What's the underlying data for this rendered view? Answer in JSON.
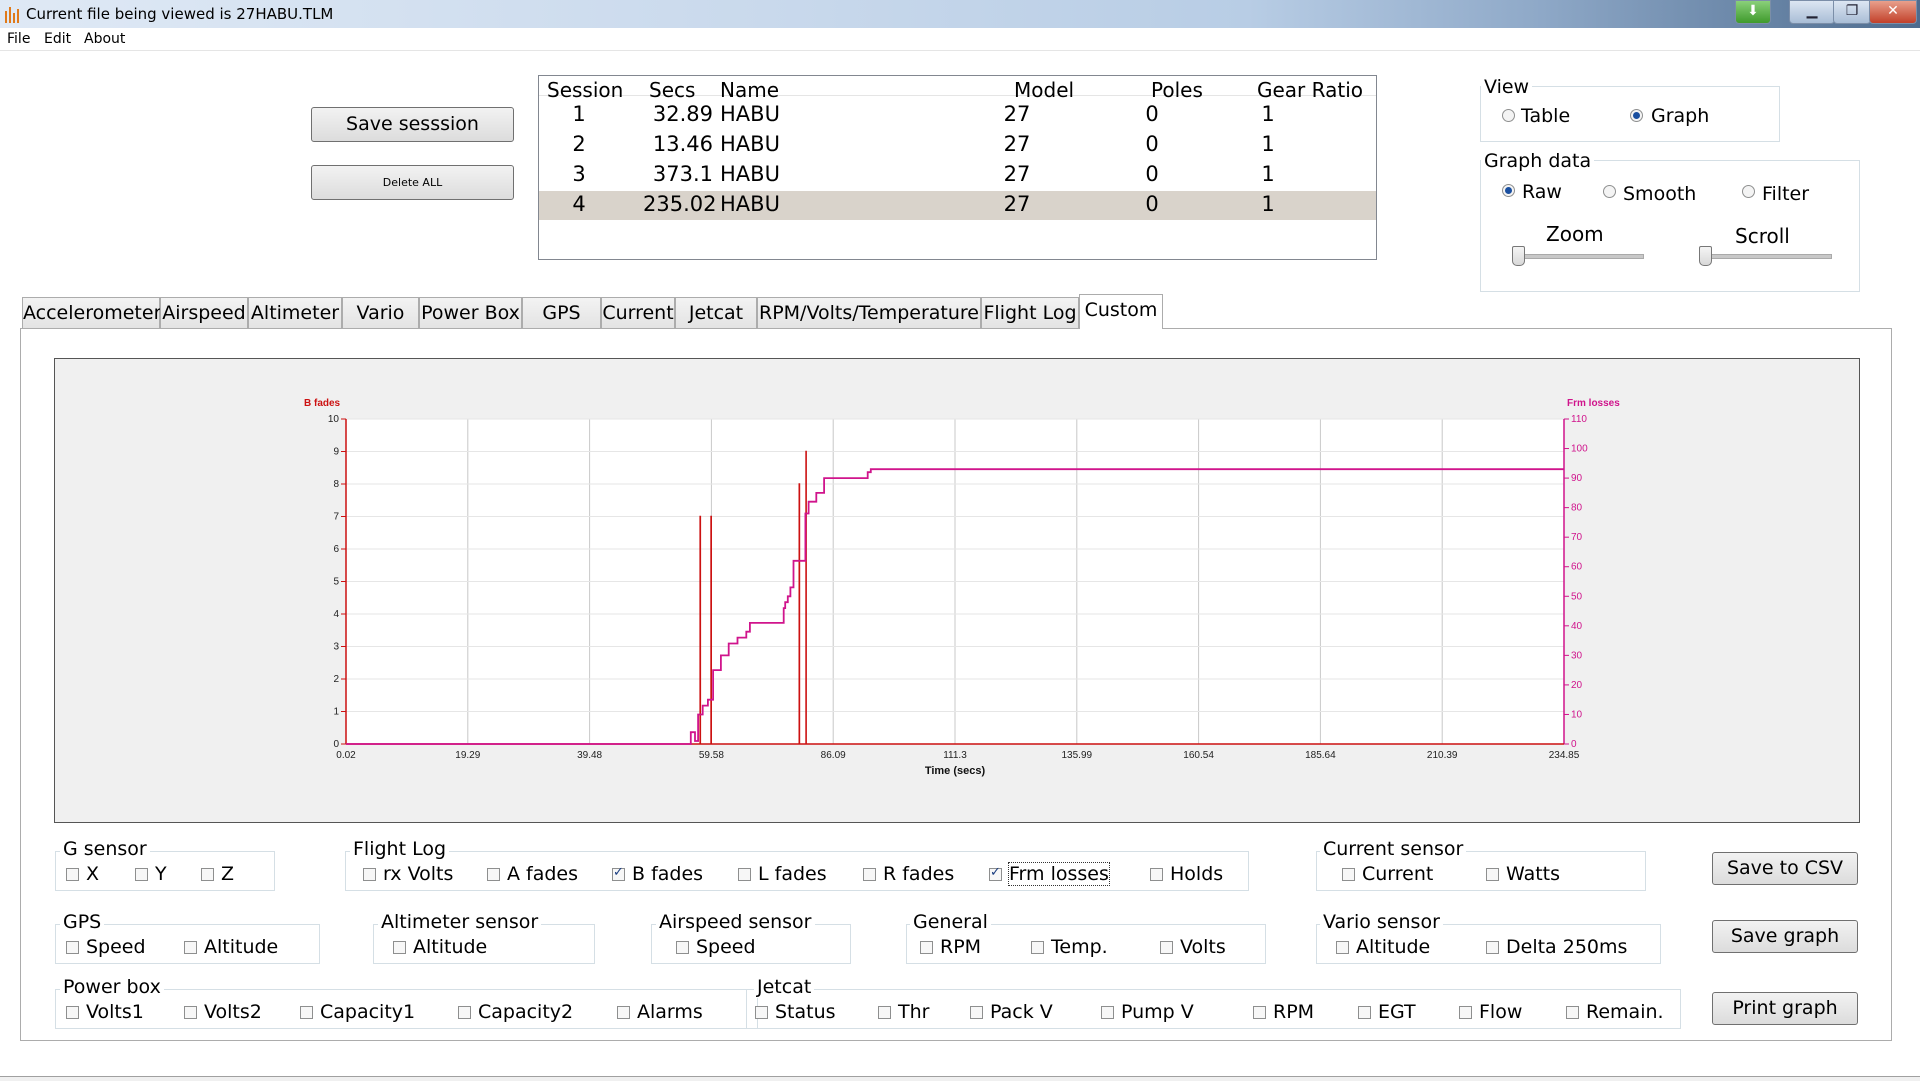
{
  "window": {
    "title": "Current file being viewed is 27HABU.TLM"
  },
  "menu": [
    "File",
    "Edit",
    "About"
  ],
  "buttons": {
    "save_session": "Save sesssion",
    "delete_all": "Delete ALL",
    "save_csv": "Save to CSV",
    "save_graph": "Save graph",
    "print_graph": "Print graph"
  },
  "sessions": {
    "headers": [
      "Session",
      "Secs",
      "Name",
      "Model",
      "Poles",
      "Gear Ratio"
    ],
    "rows": [
      [
        "1",
        "32.89",
        "HABU",
        "27",
        "0",
        "1"
      ],
      [
        "2",
        "13.46",
        "HABU",
        "27",
        "0",
        "1"
      ],
      [
        "3",
        "373.1",
        "HABU",
        "27",
        "0",
        "1"
      ],
      [
        "4",
        "235.02",
        "HABU",
        "27",
        "0",
        "1"
      ]
    ],
    "selected_row": 4
  },
  "view": {
    "label": "View",
    "options": [
      "Table",
      "Graph"
    ],
    "selected": "Graph"
  },
  "graph_data": {
    "label": "Graph data",
    "options": [
      "Raw",
      "Smooth",
      "Filter"
    ],
    "selected": "Raw",
    "zoom_label": "Zoom",
    "scroll_label": "Scroll"
  },
  "tabs": [
    "Accelerometer",
    "Airspeed",
    "Altimeter",
    "Vario",
    "Power Box",
    "GPS",
    "Current",
    "Jetcat",
    "RPM/Volts/Temperature",
    "Flight Log",
    "Custom"
  ],
  "active_tab": "Custom",
  "colors": {
    "b_fades": "#cc1111",
    "frm_losses": "#d0148c",
    "grid": "#c8c8c8"
  },
  "chart_data": {
    "type": "line",
    "xlabel": "Time (secs)",
    "x_ticks": [
      "0.02",
      "19.29",
      "39.48",
      "59.58",
      "86.09",
      "111.3",
      "135.99",
      "160.54",
      "185.64",
      "210.39",
      "234.85"
    ],
    "xlim": [
      0.02,
      234.85
    ],
    "y_left": {
      "label": "B fades",
      "ticks": [
        "0",
        "1",
        "2",
        "3",
        "4",
        "5",
        "6",
        "7",
        "8",
        "9",
        "10"
      ],
      "lim": [
        0,
        10
      ]
    },
    "y_right": {
      "label": "Frm losses",
      "ticks": [
        "0",
        "10",
        "20",
        "30",
        "40",
        "50",
        "60",
        "70",
        "80",
        "90",
        "100",
        "110"
      ],
      "lim": [
        0,
        110
      ]
    },
    "grid": true,
    "series": [
      {
        "name": "B fades",
        "axis": "left",
        "x": [
          0.02,
          68.3,
          68.3,
          68.35,
          68.35,
          70.4,
          70.4,
          70.45,
          70.45,
          87.4,
          87.4,
          87.45,
          87.45,
          88.7,
          88.7,
          88.75,
          88.75,
          234.85
        ],
        "y": [
          0,
          0,
          7,
          7,
          0,
          0,
          7,
          7,
          0,
          0,
          8,
          8,
          0,
          0,
          9,
          9,
          0,
          0
        ]
      },
      {
        "name": "Frm losses",
        "axis": "right",
        "x": [
          0.02,
          66.5,
          66.5,
          67.3,
          67.3,
          67.9,
          67.9,
          68.8,
          68.8,
          69.8,
          69.8,
          70.8,
          70.8,
          72.3,
          72.3,
          73.8,
          73.8,
          75.5,
          75.5,
          77.2,
          77.2,
          77.9,
          77.9,
          84.4,
          84.4,
          84.7,
          84.7,
          85.2,
          85.2,
          85.7,
          85.7,
          86.3,
          86.3,
          88.6,
          88.6,
          89.2,
          89.2,
          90.7,
          90.7,
          92.2,
          92.2,
          100.6,
          100.6,
          101.2,
          101.2,
          234.85
        ],
        "y": [
          0,
          0,
          4,
          4,
          1,
          1,
          10,
          10,
          13,
          13,
          15,
          15,
          25,
          25,
          30,
          30,
          34,
          34,
          36,
          36,
          38,
          38,
          41,
          41,
          46,
          46,
          48,
          48,
          50,
          50,
          53,
          53,
          62,
          62,
          78,
          78,
          82,
          82,
          85,
          85,
          90,
          90,
          92,
          92,
          93,
          93
        ]
      }
    ]
  },
  "sensors": {
    "g_sensor": {
      "label": "G sensor",
      "items": [
        [
          "X",
          false
        ],
        [
          "Y",
          false
        ],
        [
          "Z",
          false
        ]
      ]
    },
    "flight_log": {
      "label": "Flight Log",
      "items": [
        [
          "rx Volts",
          false
        ],
        [
          "A fades",
          false
        ],
        [
          "B fades",
          true
        ],
        [
          "L fades",
          false
        ],
        [
          "R fades",
          false
        ],
        [
          "Frm losses",
          true
        ],
        [
          "Holds",
          false
        ]
      ]
    },
    "current_sensor": {
      "label": "Current sensor",
      "items": [
        [
          "Current",
          false
        ],
        [
          "Watts",
          false
        ]
      ]
    },
    "gps": {
      "label": "GPS",
      "items": [
        [
          "Speed",
          false
        ],
        [
          "Altitude",
          false
        ]
      ]
    },
    "altimeter_sensor": {
      "label": "Altimeter sensor",
      "items": [
        [
          "Altitude",
          false
        ]
      ]
    },
    "airspeed_sensor": {
      "label": "Airspeed sensor",
      "items": [
        [
          "Speed",
          false
        ]
      ]
    },
    "general": {
      "label": "General",
      "items": [
        [
          "RPM",
          false
        ],
        [
          "Temp.",
          false
        ],
        [
          "Volts",
          false
        ]
      ]
    },
    "vario_sensor": {
      "label": "Vario sensor",
      "items": [
        [
          "Altitude",
          false
        ],
        [
          "Delta 250ms",
          false
        ]
      ]
    },
    "power_box": {
      "label": "Power box",
      "items": [
        [
          "Volts1",
          false
        ],
        [
          "Volts2",
          false
        ],
        [
          "Capacity1",
          false
        ],
        [
          "Capacity2",
          false
        ],
        [
          "Alarms",
          false
        ]
      ]
    },
    "jetcat": {
      "label": "Jetcat",
      "items": [
        [
          "Status",
          false
        ],
        [
          "Thr",
          false
        ],
        [
          "Pack V",
          false
        ],
        [
          "Pump V",
          false
        ],
        [
          "RPM",
          false
        ],
        [
          "EGT",
          false
        ],
        [
          "Flow",
          false
        ],
        [
          "Remain.",
          false
        ]
      ]
    }
  }
}
